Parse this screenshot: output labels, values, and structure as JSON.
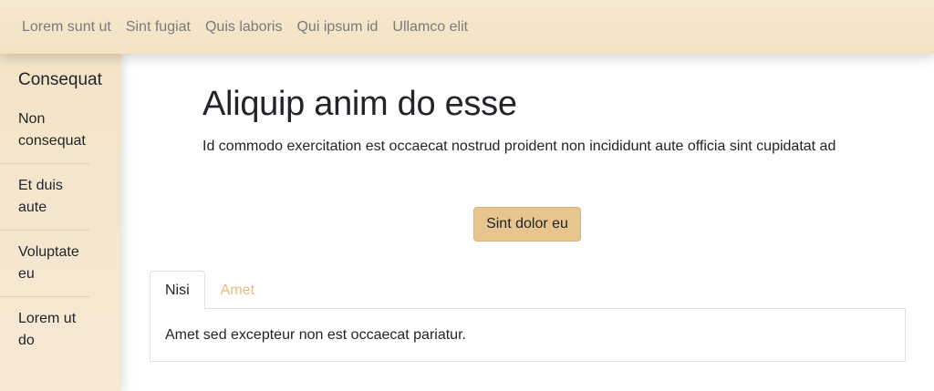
{
  "topnav": {
    "links": [
      "Lorem sunt ut",
      "Sint fugiat",
      "Quis laboris",
      "Qui ipsum id",
      "Ullamco elit"
    ]
  },
  "sidebar": {
    "title": "Consequat",
    "items": [
      {
        "label": "Non consequat"
      },
      {
        "label": "Et duis aute"
      },
      {
        "label": "Voluptate eu"
      },
      {
        "label": "Lorem ut do"
      }
    ]
  },
  "hero": {
    "title": "Aliquip anim do esse",
    "text": "Id commodo exercitation est occaecat nostrud proident non incididunt aute officia sint cupidatat ad",
    "button_label": "Sint dolor eu"
  },
  "tabs": {
    "items": [
      {
        "label": "Nisi",
        "active": true
      },
      {
        "label": "Amet",
        "active": false
      }
    ],
    "panel_text": "Amet sed excepteur non est occaecat pariatur."
  },
  "colors": {
    "nav_background": "#f3e2c4",
    "accent": "#e8c58f",
    "inactive_tab": "#e2bd82"
  }
}
